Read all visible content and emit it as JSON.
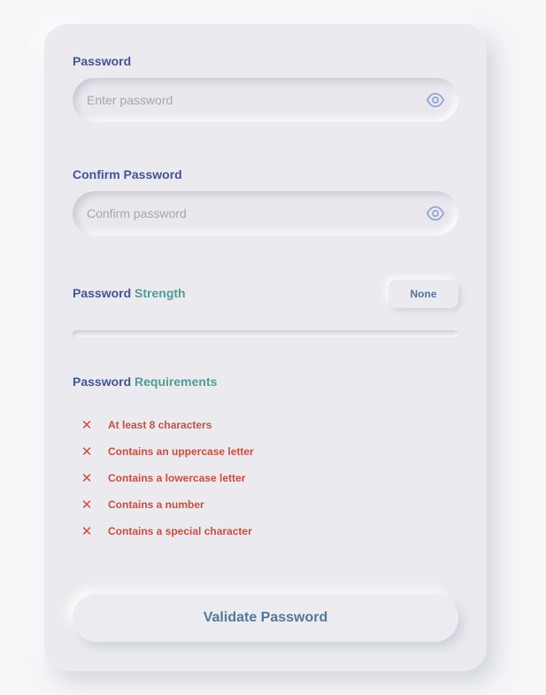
{
  "form": {
    "password": {
      "label": "Password",
      "placeholder": "Enter password",
      "value": ""
    },
    "confirm": {
      "label": "Confirm Password",
      "placeholder": "Confirm password",
      "value": ""
    }
  },
  "strength": {
    "label_part1": "Password",
    "label_part2": "Strength",
    "value": "None",
    "level": 0,
    "fill_color": "#d14a3d"
  },
  "requirements": {
    "label_part1": "Password",
    "label_part2": "Requirements",
    "items": [
      {
        "text": "At least 8 characters",
        "met": false,
        "icon": "x-icon"
      },
      {
        "text": "Contains an uppercase letter",
        "met": false,
        "icon": "x-icon"
      },
      {
        "text": "Contains a lowercase letter",
        "met": false,
        "icon": "x-icon"
      },
      {
        "text": "Contains a number",
        "met": false,
        "icon": "x-icon"
      },
      {
        "text": "Contains a special character",
        "met": false,
        "icon": "x-icon"
      }
    ]
  },
  "actions": {
    "validate_label": "Validate Password"
  },
  "icons": {
    "toggle_visibility": "eye-icon",
    "unmet": "x-icon"
  },
  "colors": {
    "label": "#45539a",
    "accent": "#4f9d97",
    "error": "#d14a3d",
    "button_text": "#527899",
    "eye_icon": "#8fa2d8"
  }
}
